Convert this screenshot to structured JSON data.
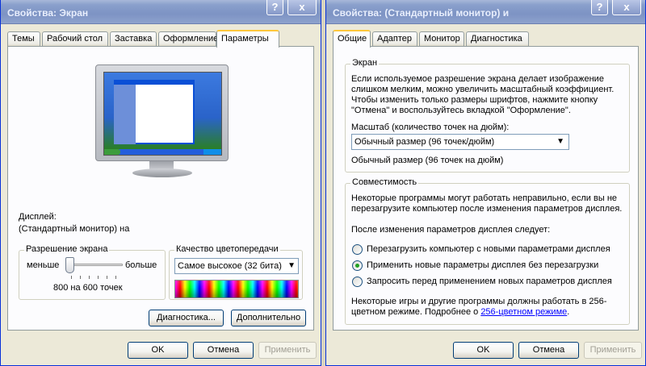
{
  "left_window": {
    "title": "Свойства: Экран",
    "help_button": "?",
    "close_button": "x",
    "tabs": [
      "Темы",
      "Рабочий стол",
      "Заставка",
      "Оформление",
      "Параметры"
    ],
    "active_tab": "Параметры",
    "display_label": "Дисплей:",
    "display_value": "(Стандартный монитор) на",
    "resolution_group": {
      "label": "Разрешение экрана",
      "less": "меньше",
      "more": "больше",
      "value": "800 на 600 точек",
      "slider_fraction": 0.0
    },
    "color_group": {
      "label": "Качество цветопередачи",
      "selected": "Самое высокое (32 бита)"
    },
    "diagnostics_button": "Диагностика...",
    "advanced_button": "Дополнительно",
    "ok_button": "OK",
    "cancel_button": "Отмена",
    "apply_button": "Применить"
  },
  "right_window": {
    "title": "Свойства: (Стандартный монитор) и",
    "help_button": "?",
    "close_button": "x",
    "tabs": [
      "Общие",
      "Адаптер",
      "Монитор",
      "Диагностика"
    ],
    "active_tab": "Общие",
    "screen_group": {
      "label": "Экран",
      "description": "Если используемое разрешение экрана делает изображение слишком мелким, можно увеличить масштабный коэффициент. Чтобы изменить только размеры шрифтов, нажмите кнопку \"Отмена\" и воспользуйтесь вкладкой \"Оформление\".",
      "scale_label": "Масштаб (количество точек на дюйм):",
      "scale_selected": "Обычный размер (96 точек/дюйм)",
      "scale_note": "Обычный размер (96 точек на дюйм)"
    },
    "compat_group": {
      "label": "Совместимость",
      "description": "Некоторые программы могут работать неправильно, если вы не перезагрузите компьютер после изменения параметров дисплея.",
      "after_change_label": "После изменения параметров дисплея следует:",
      "options": [
        "Перезагрузить компьютер с новыми параметрами дисплея",
        "Применить новые параметры дисплея без перезагрузки",
        "Запросить перед применением новых параметров дисплея"
      ],
      "selected_index": 1,
      "note_prefix": "Некоторые игры и другие программы должны работать в 256-цветном режиме. Подробнее о ",
      "note_link": "256-цветном режиме",
      "note_suffix": "."
    },
    "ok_button": "OK",
    "cancel_button": "Отмена",
    "apply_button": "Применить"
  },
  "colors": {
    "window_bg": "#ece9d8",
    "panel_bg": "#fcfcfe",
    "title_inactive": "#8aa0cc",
    "active_tab_accent": "#ffc73c",
    "link": "#0000ff"
  }
}
